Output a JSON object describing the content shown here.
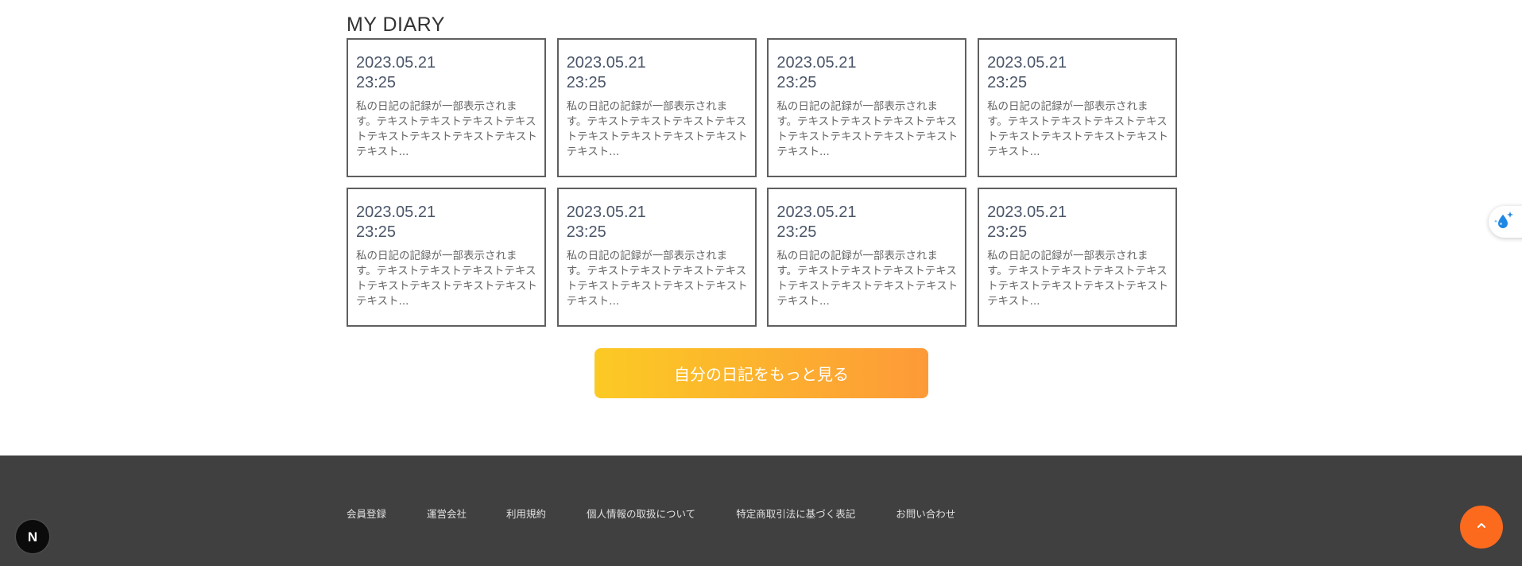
{
  "section": {
    "title": "MY DIARY"
  },
  "cards": [
    {
      "date": "2023.05.21",
      "time": "23:25",
      "excerpt": "私の日記の記録が一部表示されます。テキストテキストテキストテキストテキストテキストテキストテキストテキスト..."
    },
    {
      "date": "2023.05.21",
      "time": "23:25",
      "excerpt": "私の日記の記録が一部表示されます。テキストテキストテキストテキストテキストテキストテキストテキストテキスト..."
    },
    {
      "date": "2023.05.21",
      "time": "23:25",
      "excerpt": "私の日記の記録が一部表示されます。テキストテキストテキストテキストテキストテキストテキストテキストテキスト..."
    },
    {
      "date": "2023.05.21",
      "time": "23:25",
      "excerpt": "私の日記の記録が一部表示されます。テキストテキストテキストテキストテキストテキストテキストテキストテキスト..."
    },
    {
      "date": "2023.05.21",
      "time": "23:25",
      "excerpt": "私の日記の記録が一部表示されます。テキストテキストテキストテキストテキストテキストテキストテキストテキスト..."
    },
    {
      "date": "2023.05.21",
      "time": "23:25",
      "excerpt": "私の日記の記録が一部表示されます。テキストテキストテキストテキストテキストテキストテキストテキストテキスト..."
    },
    {
      "date": "2023.05.21",
      "time": "23:25",
      "excerpt": "私の日記の記録が一部表示されます。テキストテキストテキストテキストテキストテキストテキストテキストテキスト..."
    },
    {
      "date": "2023.05.21",
      "time": "23:25",
      "excerpt": "私の日記の記録が一部表示されます。テキストテキストテキストテキストテキストテキストテキストテキストテキスト..."
    }
  ],
  "more_button": {
    "label": "自分の日記をもっと見る"
  },
  "footer": {
    "links": [
      {
        "label": "会員登録"
      },
      {
        "label": "運営会社"
      },
      {
        "label": "利用規約"
      },
      {
        "label": "個人情報の取扱について"
      },
      {
        "label": "特定商取引法に基づく表記"
      },
      {
        "label": "お問い合わせ"
      }
    ]
  },
  "widgets": {
    "side_widget_icon": "water-drop-sparkle-icon",
    "next_badge_icon": "nextjs-logo-icon",
    "next_badge_glyph": "N",
    "scroll_top_icon": "chevron-up-icon"
  },
  "colors": {
    "button_gradient_start": "#fcca24",
    "button_gradient_end": "#fd9a38",
    "footer_bg": "#404040",
    "scroll_top_bg": "#fc6a1e",
    "card_border": "#5f5f5f"
  }
}
